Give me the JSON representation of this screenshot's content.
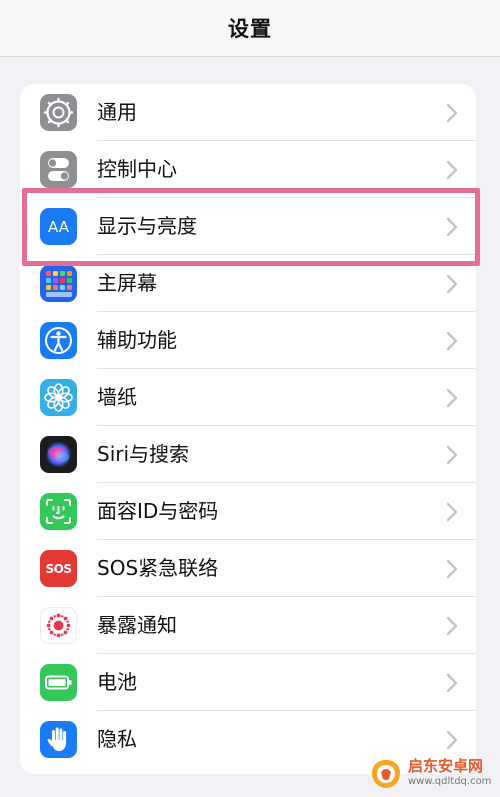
{
  "header": {
    "title": "设置"
  },
  "settings": {
    "items": [
      {
        "label": "通用",
        "icon": "gear-icon",
        "icon_bg": "#8e8e93"
      },
      {
        "label": "控制中心",
        "icon": "toggle-switches-icon",
        "icon_bg": "#8e8e93"
      },
      {
        "label": "显示与亮度",
        "icon": "display-aa-icon",
        "icon_bg": "#1a7cf5",
        "highlighted": true
      },
      {
        "label": "主屏幕",
        "icon": "home-screen-grid-icon",
        "icon_bg": "#2563eb"
      },
      {
        "label": "辅助功能",
        "icon": "accessibility-icon",
        "icon_bg": "#1a7cf5"
      },
      {
        "label": "墙纸",
        "icon": "wallpaper-flower-icon",
        "icon_bg": "#36aee6"
      },
      {
        "label": "Siri与搜索",
        "icon": "siri-icon",
        "icon_bg": "#1c1c1e"
      },
      {
        "label": "面容ID与密码",
        "icon": "face-id-icon",
        "icon_bg": "#34c759"
      },
      {
        "label": "SOS紧急联络",
        "icon": "sos-icon",
        "icon_bg": "#e53935",
        "icon_text": "SOS"
      },
      {
        "label": "暴露通知",
        "icon": "exposure-notification-icon",
        "icon_bg": "#ffffff"
      },
      {
        "label": "电池",
        "icon": "battery-icon",
        "icon_bg": "#34c759"
      },
      {
        "label": "隐私",
        "icon": "privacy-hand-icon",
        "icon_bg": "#1a7cf5"
      }
    ]
  },
  "colors": {
    "highlight": "#e76d97",
    "background": "#f2f2f6",
    "chevron": "#c4c4c7"
  },
  "watermark": {
    "brand": "启东安卓网",
    "url": "www.qdltdq.com"
  }
}
